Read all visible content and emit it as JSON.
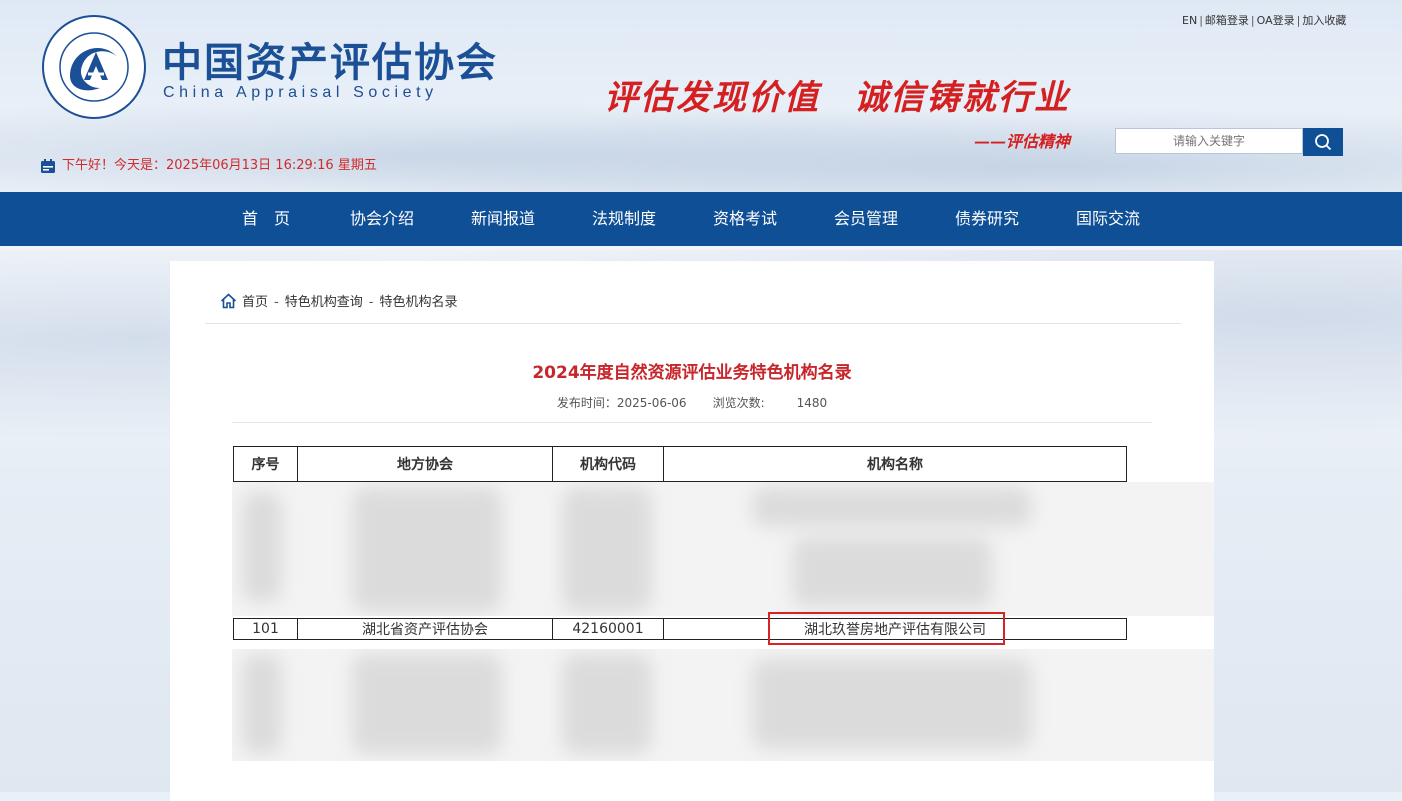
{
  "header": {
    "site_name_cn": "中国资产评估协会",
    "site_name_en": "China Appraisal Society",
    "logo_ring_text": "中国资产评估协会 China Appraisal Society",
    "top_links": [
      "EN",
      "邮箱登录",
      "OA登录",
      "加入收藏"
    ],
    "slogan_left": "评估发现价值",
    "slogan_right": "诚信铸就行业",
    "slogan_sub": "——评估精神",
    "search_placeholder": "请输入关键字",
    "greeting": "下午好！今天是：2025年06月13日 16:29:16 星期五",
    "accent_color": "#0f4f96",
    "slogan_color": "#d42020"
  },
  "nav": {
    "items": [
      "首　页",
      "协会介绍",
      "新闻报道",
      "法规制度",
      "资格考试",
      "会员管理",
      "债券研究",
      "国际交流"
    ]
  },
  "breadcrumb": {
    "items": [
      "首页",
      "特色机构查询",
      "特色机构名录"
    ],
    "separator": "-"
  },
  "article": {
    "title": "2024年度自然资源评估业务特色机构名录",
    "publish_label": "发布时间：",
    "publish_date": "2025-06-06",
    "views_label": "浏览次数:",
    "views": "1480"
  },
  "table": {
    "headers": [
      "序号",
      "地方协会",
      "机构代码",
      "机构名称"
    ],
    "visible_row": {
      "index": "101",
      "association": "湖北省资产评估协会",
      "code": "42160001",
      "name": "湖北玖誉房地产评估有限公司"
    },
    "highlight_color": "#d42424"
  }
}
